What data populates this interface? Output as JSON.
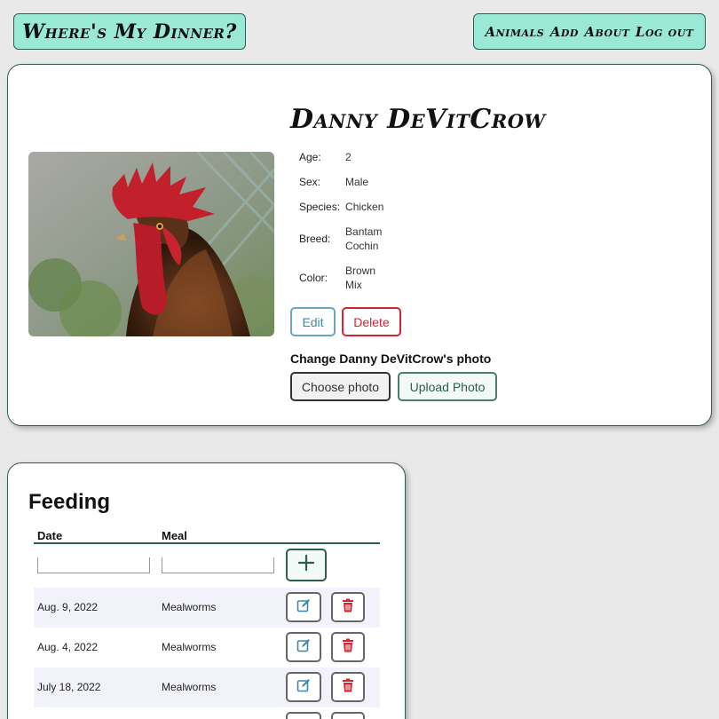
{
  "header": {
    "brand": "Where's My Dinner?"
  },
  "nav": {
    "items": [
      "Animals",
      "Add",
      "About",
      "Log out"
    ]
  },
  "animal": {
    "name": "Danny DeVitCrow",
    "fields": [
      {
        "label": "Age:",
        "value": "2"
      },
      {
        "label": "Sex:",
        "value": "Male"
      },
      {
        "label": "Species:",
        "value": "Chicken"
      },
      {
        "label": "Breed:",
        "value": "Bantam Cochin"
      },
      {
        "label": "Color:",
        "value": "Brown Mix"
      }
    ],
    "edit_label": "Edit",
    "delete_label": "Delete",
    "change_photo_label": "Change Danny DeVitCrow's photo",
    "choose_photo_label": "Choose photo",
    "upload_photo_label": "Upload Photo"
  },
  "feeding": {
    "title": "Feeding",
    "columns": [
      "Date",
      "Meal"
    ],
    "new_date_value": "",
    "new_meal_value": "",
    "add_icon": "plus-icon",
    "rows": [
      {
        "date": "Aug. 9, 2022",
        "meal": "Mealworms"
      },
      {
        "date": "Aug. 4, 2022",
        "meal": "Mealworms"
      },
      {
        "date": "July 18, 2022",
        "meal": "Mealworms"
      }
    ],
    "edit_icon": "edit-icon",
    "delete_icon": "trash-icon"
  },
  "colors": {
    "accent": "#99e9d6",
    "border": "#2f5d50",
    "danger": "#d22534",
    "info": "#3f86a6"
  }
}
